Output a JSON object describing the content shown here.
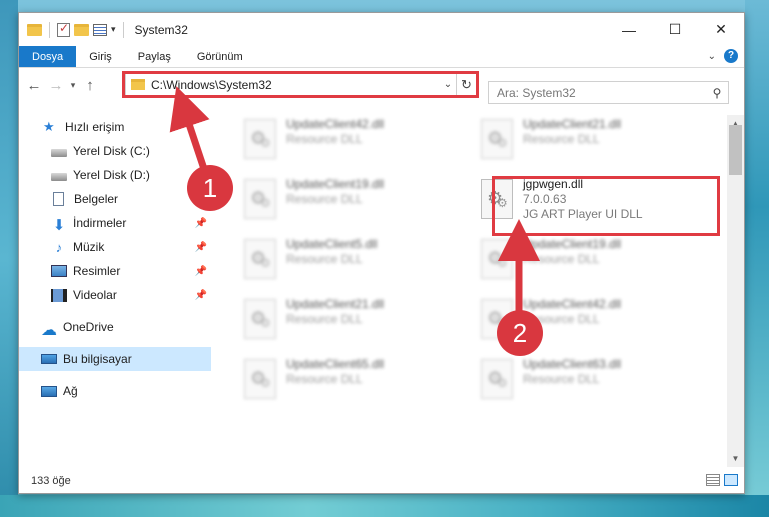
{
  "window": {
    "title": "System32",
    "controls": {
      "minimize": "—",
      "maximize": "☐",
      "close": "✕"
    }
  },
  "ribbon": {
    "tabs": [
      "Dosya",
      "Giriş",
      "Paylaş",
      "Görünüm"
    ]
  },
  "navigation": {
    "back": "←",
    "forward": "→",
    "recent": "▾",
    "up": "↑",
    "address": "C:\\Windows\\System32",
    "search_placeholder": "Ara: System32"
  },
  "sidebar": {
    "items": [
      {
        "label": "Hızlı erişim",
        "icon": "star-icon"
      },
      {
        "label": "Yerel Disk (C:)",
        "icon": "drive-icon"
      },
      {
        "label": "Yerel Disk (D:)",
        "icon": "drive-icon"
      },
      {
        "label": "Belgeler",
        "icon": "documents-icon"
      },
      {
        "label": "İndirmeler",
        "icon": "downloads-icon",
        "pinned": true
      },
      {
        "label": "Müzik",
        "icon": "music-icon",
        "pinned": true
      },
      {
        "label": "Resimler",
        "icon": "pictures-icon",
        "pinned": true
      },
      {
        "label": "Videolar",
        "icon": "videos-icon",
        "pinned": true
      },
      {
        "label": "OneDrive",
        "icon": "onedrive-icon"
      },
      {
        "label": "Bu bilgisayar",
        "icon": "computer-icon",
        "selected": true
      },
      {
        "label": "Ağ",
        "icon": "network-icon"
      }
    ]
  },
  "files": {
    "left": [
      {
        "name": "UpdateClient42.dll",
        "type": "Resource DLL"
      },
      {
        "name": "UpdateClient19.dll",
        "type": "Resource DLL"
      },
      {
        "name": "UpdateClient5.dll",
        "type": "Resource DLL"
      },
      {
        "name": "UpdateClient21.dll",
        "type": "Resource DLL"
      },
      {
        "name": "UpdateClient65.dll",
        "type": "Resource DLL"
      }
    ],
    "right": [
      {
        "name": "UpdateClient21.dll",
        "type": "Resource DLL"
      },
      {
        "name": "jgpwgen.dll",
        "version": "7.0.0.63",
        "description": "JG ART Player UI DLL",
        "highlighted": true
      },
      {
        "name": "UpdateClient19.dll",
        "type": "Resource DLL"
      },
      {
        "name": "UpdateClient42.dll",
        "type": "Resource DLL"
      },
      {
        "name": "UpdateClient63.dll",
        "type": "Resource DLL"
      }
    ]
  },
  "status": {
    "item_count": "133 öğe"
  },
  "annotations": {
    "marker1": "1",
    "marker2": "2",
    "color": "#d9373f"
  },
  "accent": "#1979ca"
}
